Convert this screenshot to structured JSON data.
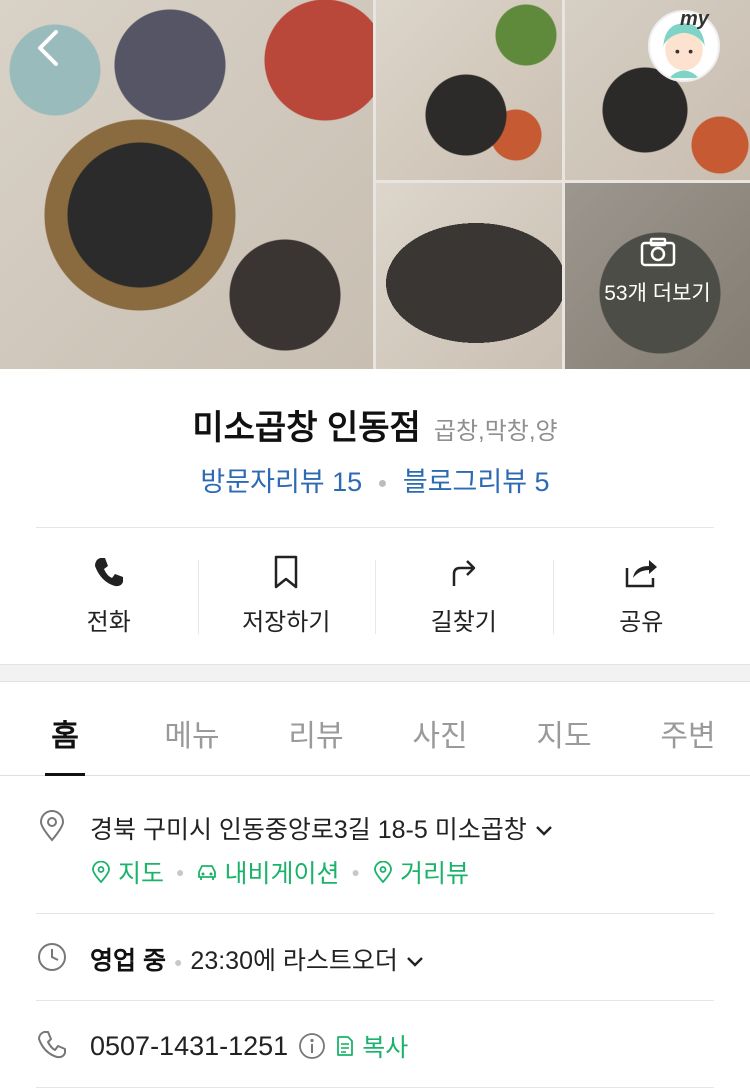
{
  "gallery": {
    "more_label": "53개 더보기",
    "my_label": "my"
  },
  "place": {
    "name": "미소곱창 인동점",
    "category": "곱창,막창,양"
  },
  "reviews": {
    "visitor": "방문자리뷰 15",
    "blog": "블로그리뷰 5"
  },
  "actions": [
    {
      "label": "전화",
      "icon": "phone-icon"
    },
    {
      "label": "저장하기",
      "icon": "bookmark-icon"
    },
    {
      "label": "길찾기",
      "icon": "directions-icon"
    },
    {
      "label": "공유",
      "icon": "share-icon"
    }
  ],
  "tabs": [
    "홈",
    "메뉴",
    "리뷰",
    "사진",
    "지도",
    "주변"
  ],
  "active_tab": "홈",
  "address": {
    "text": "경북 구미시 인동중앙로3길 18-5 미소곱창",
    "links": [
      "지도",
      "내비게이션",
      "거리뷰"
    ]
  },
  "hours": {
    "status": "영업 중",
    "detail": "23:30에 라스트오더"
  },
  "phone": {
    "number": "0507-1431-1251",
    "copy_label": "복사"
  },
  "colors": {
    "review_link": "#2c6ab3",
    "green_link": "#1bb36a"
  }
}
